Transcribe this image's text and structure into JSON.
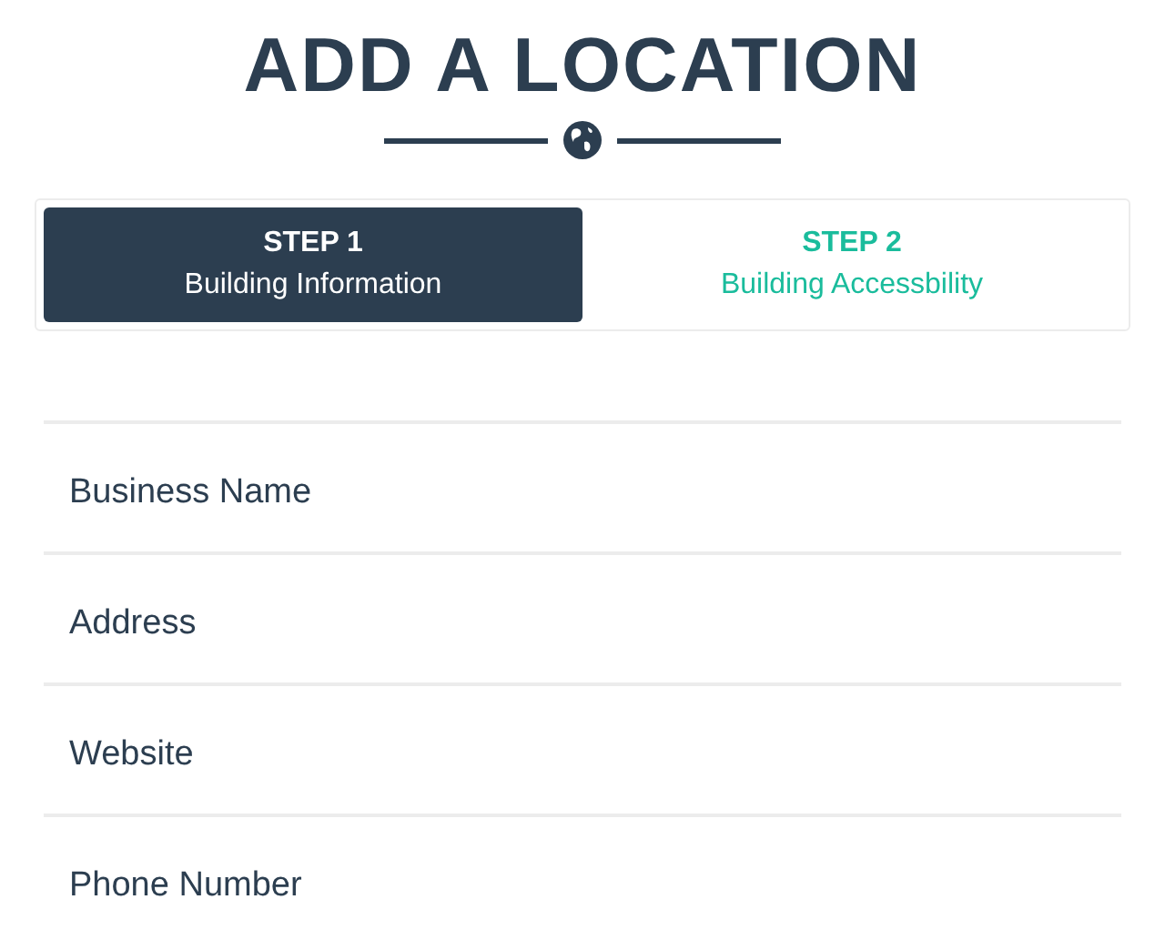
{
  "title": "ADD A LOCATION",
  "steps": [
    {
      "step": "STEP 1",
      "label": "Building Information",
      "selected": true
    },
    {
      "step": "STEP 2",
      "label": "Building Accessbility",
      "selected": false
    }
  ],
  "fields": [
    {
      "placeholder": "Business Name"
    },
    {
      "placeholder": "Address"
    },
    {
      "placeholder": "Website"
    },
    {
      "placeholder": "Phone Number"
    }
  ]
}
